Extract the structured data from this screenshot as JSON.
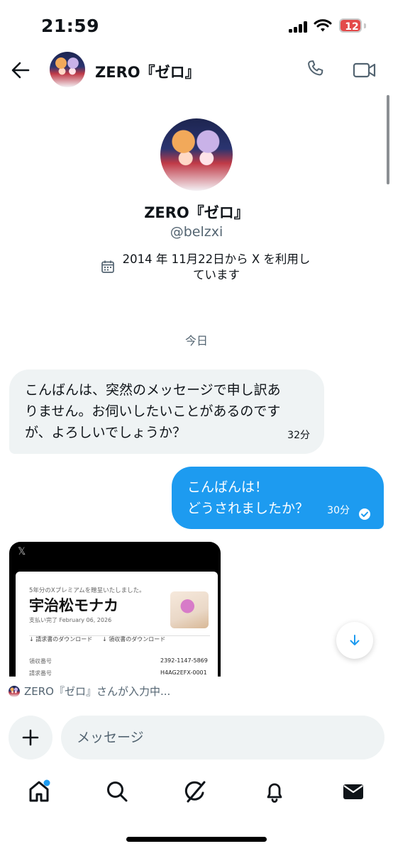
{
  "status_bar": {
    "time": "21:59",
    "battery": "12"
  },
  "header": {
    "name": "ZERO『ゼロ』"
  },
  "profile": {
    "name": "ZERO『ゼロ』",
    "handle": "@belzxi",
    "joined_line1": "2014 年 11月22日から X を利用し",
    "joined_line2": "ています"
  },
  "conversation": {
    "day_label": "今日",
    "messages": [
      {
        "side": "received",
        "text_lines": [
          "こんばんは、突然のメッセージで申し訳あ",
          "りません。お伺いしたいことがあるのです",
          "が、よろしいでしょうか？"
        ],
        "time": "32分"
      },
      {
        "side": "sent",
        "text_lines": [
          "こんばんは！",
          "どうされましたか？"
        ],
        "time": "30分",
        "status": "read"
      }
    ],
    "receipt_image": {
      "logo": "𝕏",
      "heading": "5年分のXプレミアムを贈呈いたしました。",
      "title": "宇治松モナカ",
      "paid": "支払い完了 February 06, 2026",
      "download1": "↓ 請求書のダウンロード",
      "download2": "↓ 領収書のダウンロード",
      "row1_label": "領収番号",
      "row1_value": "2392-1147-5869",
      "row2_label": "請求番号",
      "row2_value": "H4AG2EFX-0001"
    },
    "typing": "ZERO『ゼロ』さんが入力中..."
  },
  "composer": {
    "placeholder": "メッセージ"
  },
  "nav": [
    "home",
    "explore",
    "grok",
    "notifications",
    "messages"
  ]
}
